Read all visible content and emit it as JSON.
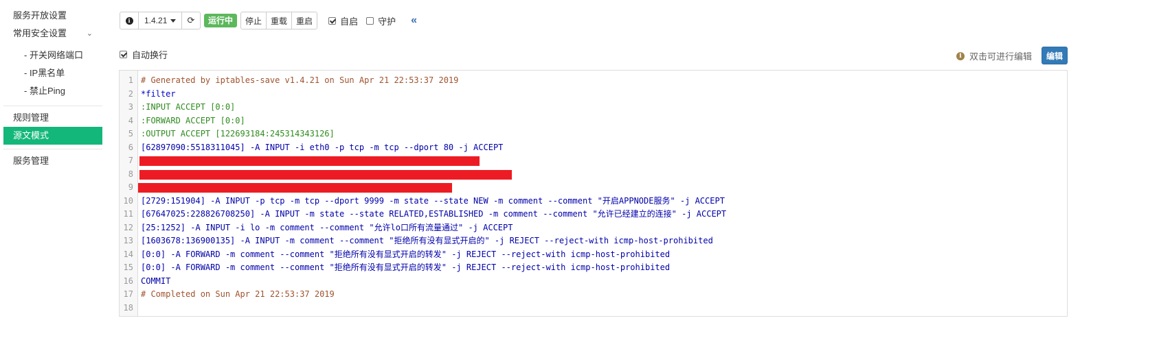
{
  "sidebar": {
    "items": [
      {
        "label": "服务开放设置"
      },
      {
        "label": "常用安全设置"
      },
      {
        "label": "- 开关网络端口"
      },
      {
        "label": "- IP黑名单"
      },
      {
        "label": "- 禁止Ping"
      },
      {
        "label": "规则管理"
      },
      {
        "label": "源文模式"
      },
      {
        "label": "服务管理"
      }
    ],
    "active_index": 6
  },
  "toolbar": {
    "version": "1.4.21",
    "status": "运行中",
    "stop_label": "停止",
    "reload_label": "重载",
    "restart_label": "重启",
    "autostart_label": "自启",
    "autostart_checked": true,
    "guard_label": "守护",
    "guard_checked": false,
    "icons": [
      "info-icon",
      "refresh-icon",
      "chevron-double-left-icon"
    ]
  },
  "options": {
    "autowrap_label": "自动换行",
    "autowrap_checked": true,
    "hint": "双击可进行编辑",
    "edit_label": "编辑"
  },
  "editor": {
    "lines": [
      {
        "n": "1",
        "text": "# Generated by iptables-save v1.4.21 on Sun Apr 21 22:53:37 2019",
        "style": "comment"
      },
      {
        "n": "2",
        "text": "*filter",
        "style": "blue"
      },
      {
        "n": "3",
        "text": ":INPUT ACCEPT [0:0]",
        "style": "green"
      },
      {
        "n": "4",
        "text": ":FORWARD ACCEPT [0:0]",
        "style": "green"
      },
      {
        "n": "5",
        "text": ":OUTPUT ACCEPT [122693184:245314343126]",
        "style": "green"
      },
      {
        "n": "6",
        "text": "[62897090:5518311045] -A INPUT -i eth0 -p tcp -m tcp --dport 80 -j ACCEPT",
        "style": "navy"
      },
      {
        "n": "7",
        "text": "",
        "style": "redacted"
      },
      {
        "n": "8",
        "text": "",
        "style": "redacted"
      },
      {
        "n": "9",
        "text": "",
        "style": "redacted"
      },
      {
        "n": "10",
        "text": "[2729:151904] -A INPUT -p tcp -m tcp --dport 9999 -m state --state NEW -m comment --comment \"开启APPNODE服务\" -j ACCEPT",
        "style": "navy"
      },
      {
        "n": "11",
        "text": "[67647025:228826708250] -A INPUT -m state --state RELATED,ESTABLISHED -m comment --comment \"允许已经建立的连接\" -j ACCEPT",
        "style": "navy"
      },
      {
        "n": "12",
        "text": "[25:1252] -A INPUT -i lo -m comment --comment \"允许lo口所有流量通过\" -j ACCEPT",
        "style": "navy"
      },
      {
        "n": "13",
        "text": "[1603678:136900135] -A INPUT -m comment --comment \"拒绝所有没有显式开启的\" -j REJECT --reject-with icmp-host-prohibited",
        "style": "navy"
      },
      {
        "n": "14",
        "text": "[0:0] -A FORWARD -m comment --comment \"拒绝所有没有显式开启的转发\" -j REJECT --reject-with icmp-host-prohibited",
        "style": "navy"
      },
      {
        "n": "15",
        "text": "[0:0] -A FORWARD -m comment --comment \"拒绝所有没有显式开启的转发\" -j REJECT --reject-with icmp-host-prohibited",
        "style": "navy"
      },
      {
        "n": "16",
        "text": "COMMIT",
        "style": "navy"
      },
      {
        "n": "17",
        "text": "# Completed on Sun Apr 21 22:53:37 2019",
        "style": "comment"
      },
      {
        "n": "18",
        "text": "",
        "style": "navy"
      }
    ]
  },
  "colors": {
    "accent": "#13b77a",
    "running": "#5cb85c",
    "primary": "#337ab7",
    "redaction": "#ed1c24"
  }
}
